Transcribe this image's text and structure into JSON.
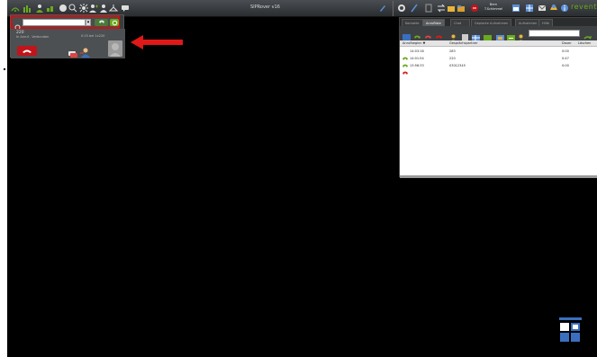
{
  "app": {
    "title": "SIPRover v16",
    "logo": "reventix"
  },
  "topbar": {
    "left_icons": [
      "signal-icon",
      "stats-icon",
      "people-icon",
      "status-icon",
      "circle-icon",
      "user-search-icon",
      "sun-icon",
      "person-add-icon",
      "person-icon",
      "hanger-icon",
      "chat-icon"
    ],
    "right_icons": [
      "brush-icon",
      "search-icon",
      "paint-icon",
      "doc-icon",
      "transfer-icon",
      "folder-icon",
      "voicemail-icon",
      "calendar-icon",
      "grid-icon",
      "mail-icon",
      "hat-icon",
      "info-icon"
    ],
    "voicemail_label_1": "Bern",
    "voicemail_label_2": "T.Schimmel"
  },
  "phone": {
    "dial_placeholder": "",
    "selector": "▾",
    "call_number": "220",
    "call_status": "In Anruf - Verbunden",
    "call_meta": "0:15 bei 1x220"
  },
  "log": {
    "tabs": [
      "Kontakte",
      "Anrufliste",
      "Chat",
      "Geplante Aufnahmen",
      "Aufnahmen",
      "Hilfe"
    ],
    "active_tab": 1,
    "search_value": "",
    "columns": [
      "Anrufbeginn",
      "Gesprächspartner",
      "Dauer",
      "Löschen"
    ],
    "sort_indicator": "▼",
    "rows": [
      {
        "time": "14:03:16",
        "partner": "283",
        "duration": "0:00",
        "type": "incoming"
      },
      {
        "time": "14:01:54",
        "partner": "220",
        "duration": "0:47",
        "type": "incoming"
      },
      {
        "time": "13:56:33",
        "partner": "03012345",
        "duration": "0:00",
        "type": "missed"
      }
    ]
  },
  "colors": {
    "accent_green": "#6aaa1f",
    "hangup_red": "#c0151b",
    "annotation_red": "#e01818",
    "widget_blue": "#3a6fbf"
  }
}
